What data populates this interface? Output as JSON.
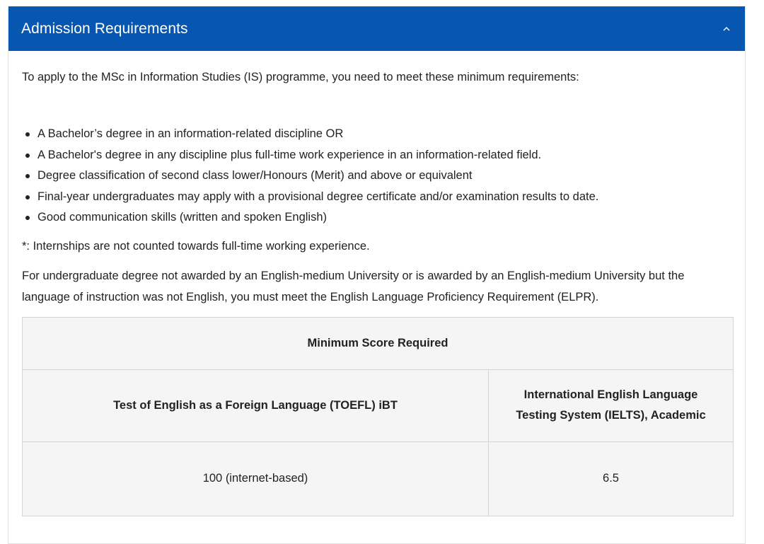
{
  "accordion": {
    "title": "Admission Requirements",
    "toggle_icon": "chevron-up-icon",
    "header_color": "#0757b0"
  },
  "content": {
    "intro": "To apply to the MSc in Information Studies (IS) programme, you need to meet these minimum requirements:",
    "requirements": [
      "A Bachelor’s degree in an information-related discipline OR",
      "A Bachelor's degree in any discipline plus full-time work experience in an information-related field.",
      "Degree classification of second class lower/Honours (Merit) and above or equivalent",
      "Final-year undergraduates may apply with a provisional degree certificate and/or examination results to date.",
      "Good communication skills (written and spoken English)"
    ],
    "note": "*: Internships are not counted towards full-time working experience.",
    "elpr": "For undergraduate degree not awarded by an English-medium University or is awarded by an English-medium University but the language of instruction was not English, you must meet the English Language Proficiency Requirement (ELPR)."
  },
  "table": {
    "header": "Minimum Score Required",
    "tests": [
      "Test of English as a Foreign Language (TOEFL) iBT",
      "International English Language Testing System (IELTS), Academic"
    ],
    "scores": [
      "100 (internet-based)",
      "6.5"
    ]
  }
}
